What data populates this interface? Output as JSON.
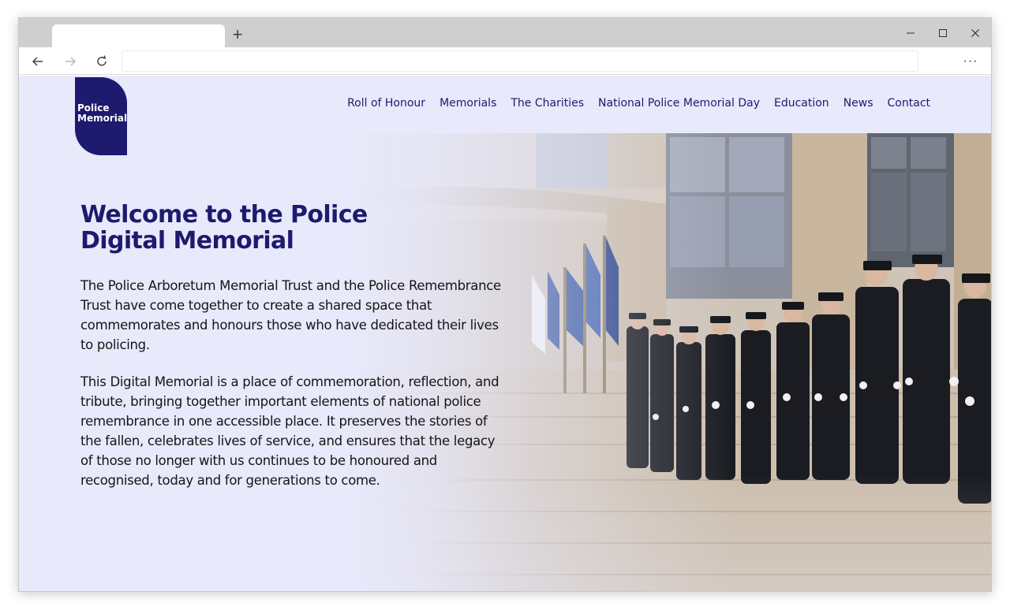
{
  "browser": {
    "tab_title": "",
    "new_tab_icon": "plus-icon",
    "address": "",
    "controls": [
      "minimize-icon",
      "maximize-icon",
      "close-icon"
    ]
  },
  "site": {
    "logo": {
      "line1": "Police",
      "line2": "Memorial"
    },
    "nav": [
      {
        "label": "Roll of Honour"
      },
      {
        "label": "Memorials"
      },
      {
        "label": "The Charities"
      },
      {
        "label": "National Police Memorial Day"
      },
      {
        "label": "Education"
      },
      {
        "label": "News"
      },
      {
        "label": "Contact"
      }
    ],
    "hero": {
      "title": "Welcome to the Police Digital Memorial",
      "paragraph1": "The Police Arboretum Memorial Trust and the Police Remembrance Trust have come together to create a shared space that commemorates and honours those who have dedicated their lives to policing.",
      "paragraph2": "This Digital Memorial is a place of commemoration, reflection, and tribute, bringing together important elements of national police remembrance in one accessible place. It preserves the stories of the fallen, celebrates lives of service, and ensures that the legacy of those no longer with us continues to be honoured and recognised, today and for generations to come."
    }
  },
  "colors": {
    "brand_navy": "#1e1a6e",
    "page_background": "#e8e9fb"
  }
}
